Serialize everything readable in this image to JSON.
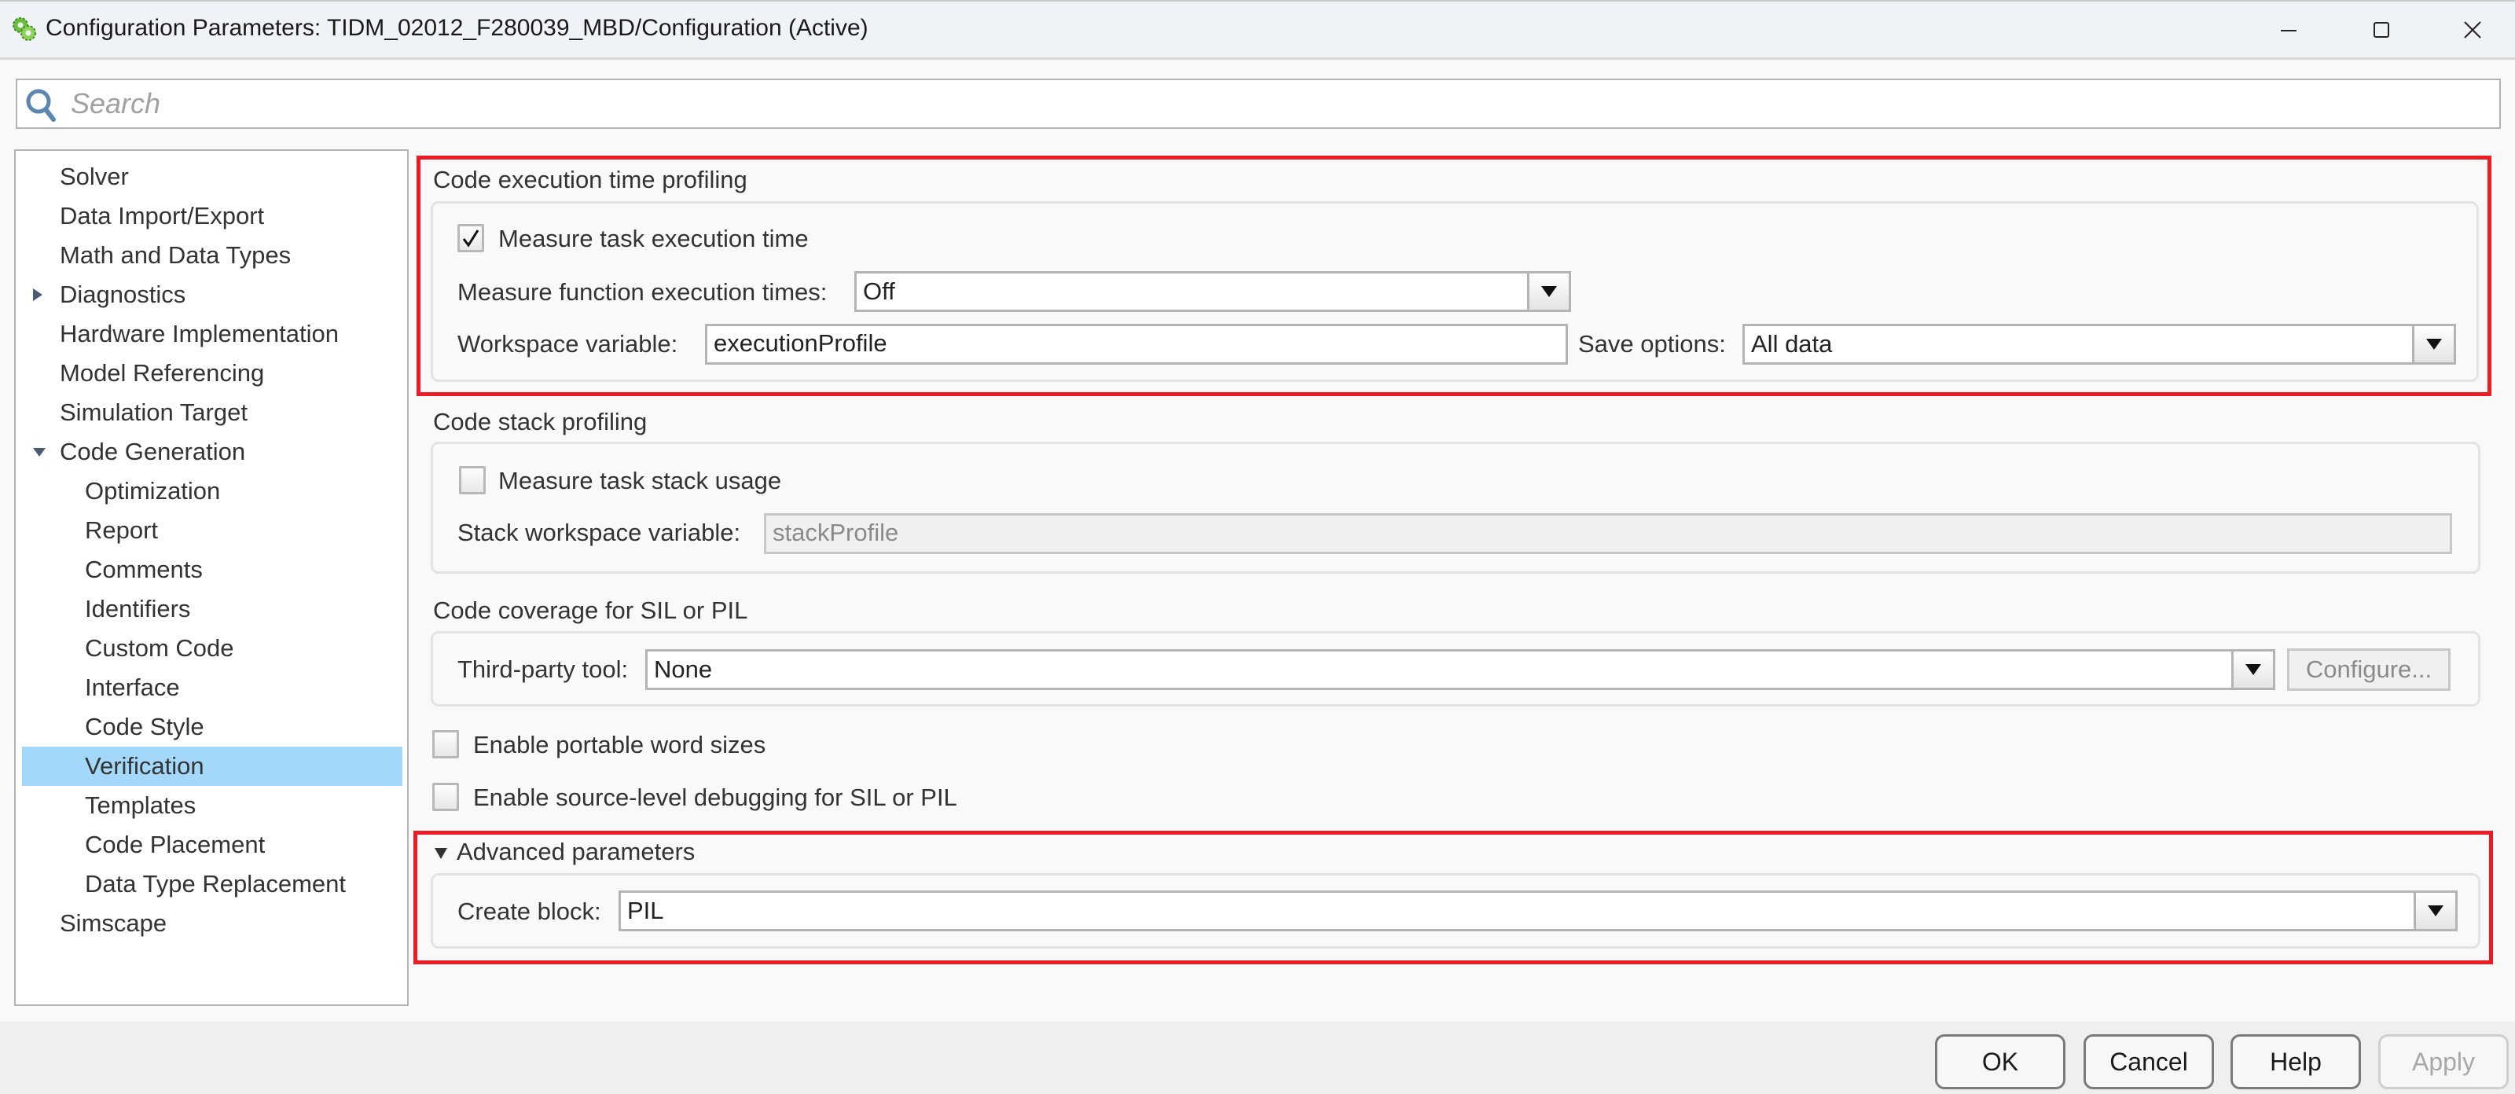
{
  "window": {
    "title": "Configuration Parameters: TIDM_02012_F280039_MBD/Configuration (Active)",
    "icon": "gears-icon",
    "controls": [
      "minimize-icon",
      "maximize-icon",
      "close-icon"
    ]
  },
  "search": {
    "placeholder": "Search",
    "value": ""
  },
  "tree": {
    "items": [
      {
        "label": "Solver",
        "level": 0
      },
      {
        "label": "Data Import/Export",
        "level": 0
      },
      {
        "label": "Math and Data Types",
        "level": 0
      },
      {
        "label": "Diagnostics",
        "level": 0,
        "toggle": "collapsed"
      },
      {
        "label": "Hardware Implementation",
        "level": 0
      },
      {
        "label": "Model Referencing",
        "level": 0
      },
      {
        "label": "Simulation Target",
        "level": 0
      },
      {
        "label": "Code Generation",
        "level": 0,
        "toggle": "expanded"
      },
      {
        "label": "Optimization",
        "level": 1
      },
      {
        "label": "Report",
        "level": 1
      },
      {
        "label": "Comments",
        "level": 1
      },
      {
        "label": "Identifiers",
        "level": 1
      },
      {
        "label": "Custom Code",
        "level": 1
      },
      {
        "label": "Interface",
        "level": 1
      },
      {
        "label": "Code Style",
        "level": 1
      },
      {
        "label": "Verification",
        "level": 1,
        "selected": true
      },
      {
        "label": "Templates",
        "level": 1
      },
      {
        "label": "Code Placement",
        "level": 1
      },
      {
        "label": "Data Type Replacement",
        "level": 1
      },
      {
        "label": "Simscape",
        "level": 0
      }
    ]
  },
  "exec_profiling": {
    "title": "Code execution time profiling",
    "measure_task_label": "Measure task execution time",
    "measure_task_checked": true,
    "measure_function_label": "Measure function execution times:",
    "measure_function_value": "Off",
    "workspace_label": "Workspace variable:",
    "workspace_value": "executionProfile",
    "save_options_label": "Save options:",
    "save_options_value": "All data"
  },
  "stack_profiling": {
    "title": "Code stack profiling",
    "measure_stack_label": "Measure task stack usage",
    "measure_stack_checked": false,
    "stack_workspace_label": "Stack workspace variable:",
    "stack_workspace_value": "stackProfile"
  },
  "code_coverage": {
    "title": "Code coverage for SIL or PIL",
    "tool_label": "Third-party tool:",
    "tool_value": "None",
    "configure_label": "Configure..."
  },
  "options": {
    "portable_word_sizes_label": "Enable portable word sizes",
    "portable_word_sizes_checked": false,
    "source_debug_label": "Enable source-level debugging for SIL or PIL",
    "source_debug_checked": false
  },
  "advanced": {
    "title": "Advanced parameters",
    "expanded": true,
    "create_block_label": "Create block:",
    "create_block_value": "PIL"
  },
  "footer": {
    "ok": "OK",
    "cancel": "Cancel",
    "help": "Help",
    "apply": "Apply"
  },
  "colors": {
    "highlight_box": "#ec1c24",
    "selection": "#a3d8fb"
  }
}
